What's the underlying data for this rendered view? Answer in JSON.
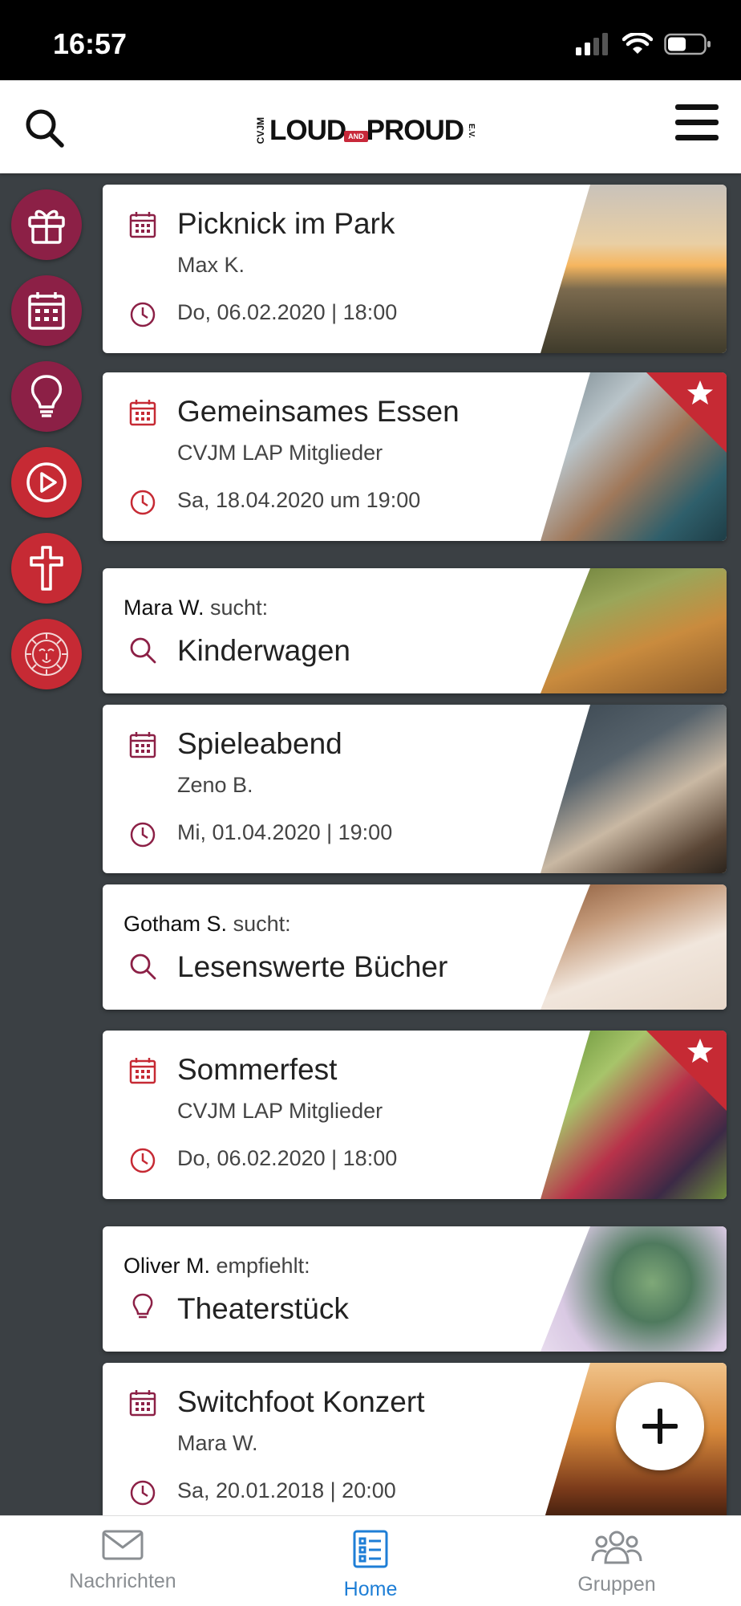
{
  "status": {
    "time": "16:57"
  },
  "header": {
    "logo_side": "CVJM",
    "logo_loud": "LOUD",
    "logo_and": "AND",
    "logo_proud": "PROUD",
    "logo_ev": "E.V."
  },
  "sidebar": {
    "items": [
      "gift-icon",
      "calendar-icon",
      "lightbulb-icon",
      "play-icon",
      "cross-icon",
      "lion-icon"
    ]
  },
  "cards": [
    {
      "type": "event",
      "title": "Picknick im Park",
      "sub": "Max K.",
      "date": "Do, 06.02.2020 | 18:00",
      "featured": false
    },
    {
      "type": "event",
      "title": "Gemeinsames Essen",
      "sub": "CVJM LAP Mitglieder",
      "date": "Sa, 18.04.2020 um 19:00",
      "featured": true
    },
    {
      "type": "search",
      "who": "Mara W.",
      "verb": "sucht:",
      "title": "Kinderwagen"
    },
    {
      "type": "event",
      "title": "Spieleabend",
      "sub": "Zeno B.",
      "date": "Mi, 01.04.2020 | 19:00",
      "featured": false
    },
    {
      "type": "search",
      "who": "Gotham S.",
      "verb": "sucht:",
      "title": "Lesenswerte Bücher"
    },
    {
      "type": "event",
      "title": "Sommerfest",
      "sub": "CVJM LAP Mitglieder",
      "date": "Do, 06.02.2020 | 18:00",
      "featured": true
    },
    {
      "type": "recommend",
      "who": "Oliver M.",
      "verb": "empfiehlt:",
      "title": "Theaterstück"
    },
    {
      "type": "event",
      "title": "Switchfoot Konzert",
      "sub": "Mara W.",
      "date": "Sa, 20.01.2018 | 20:00",
      "featured": false
    }
  ],
  "tabs": [
    {
      "label": "Nachrichten",
      "active": false
    },
    {
      "label": "Home",
      "active": true
    },
    {
      "label": "Gruppen",
      "active": false
    }
  ],
  "colors": {
    "brand": "#8c2046",
    "accent_red": "#c62a34",
    "active_tab": "#1e7ed6"
  }
}
